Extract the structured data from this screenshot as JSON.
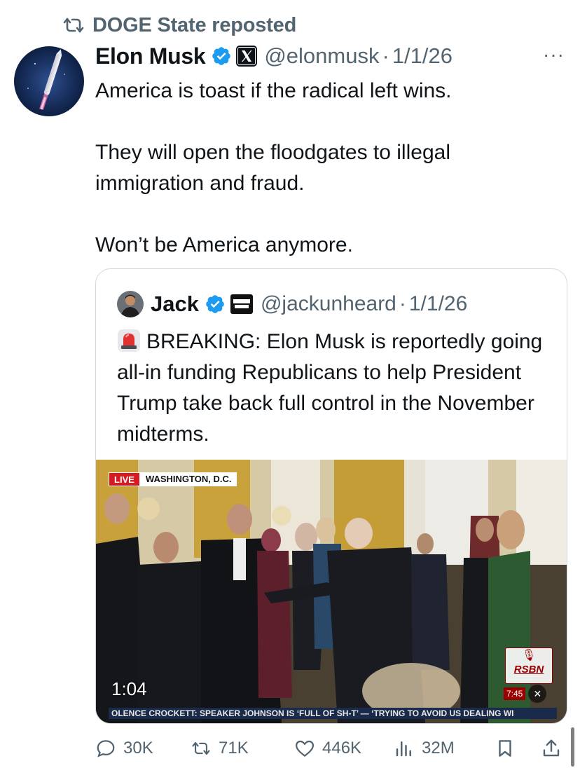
{
  "repost": {
    "text": "DOGE State reposted",
    "icon": "repost-icon"
  },
  "tweet": {
    "author_name": "Elon Musk",
    "verified": true,
    "affiliate_badge": "x-logo",
    "handle": "@elonmusk",
    "date": "1/1/26",
    "more_label": "···",
    "paragraphs": [
      "America is toast if the radical left wins.",
      "They will open the floodgates to illegal immigration and fraud.",
      "Won’t be America anymore."
    ]
  },
  "quote": {
    "author_name": "Jack",
    "verified": true,
    "affiliate_badge": "benny-show-logo",
    "handle": "@jackunheard",
    "date": "1/1/26",
    "text": "BREAKING: Elon Musk is reportedly going all-in funding Republicans to help President Trump take back full control in the November midterms.",
    "emoji": "siren-icon",
    "video": {
      "live_label": "LIVE",
      "location": "WASHINGTON, D.C.",
      "duration": "1:04",
      "channel_logo": "RSBN",
      "clock": "7:45",
      "ticker": "OLENCE    CROCKETT: SPEAKER JOHNSON IS ‘FULL OF SH-T’ — ‘TRYING TO AVOID US DEALING WI"
    }
  },
  "actions": {
    "replies": "30K",
    "reposts": "71K",
    "likes": "446K",
    "views": "32M"
  },
  "colors": {
    "text": "#0f1419",
    "secondary": "#536471",
    "verified_blue": "#1d9bf0",
    "border": "#cfd9de",
    "live_red": "#d71920"
  }
}
